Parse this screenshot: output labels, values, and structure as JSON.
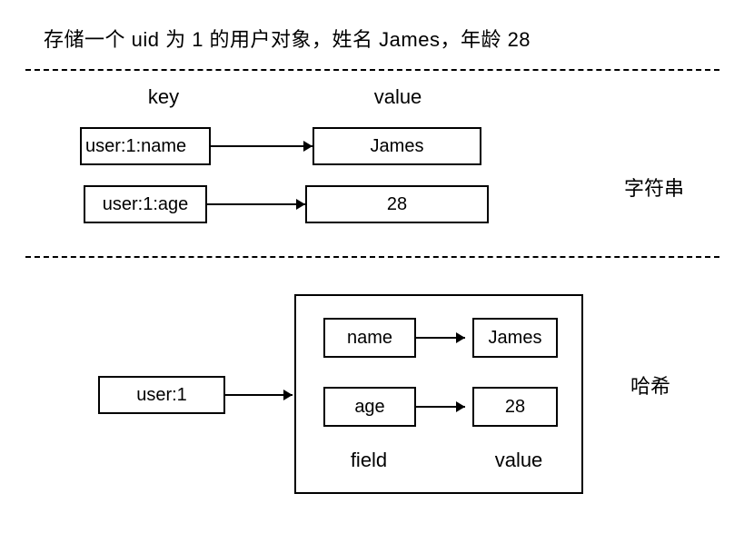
{
  "title": "存储一个 uid 为 1 的用户对象，姓名 James，年龄 28",
  "headers": {
    "key": "key",
    "value": "value",
    "field": "field",
    "value2": "value"
  },
  "section_labels": {
    "string": "字符串",
    "hash": "哈希"
  },
  "string_section": {
    "row1": {
      "key": "user:1:name",
      "value": "James"
    },
    "row2": {
      "key": "user:1:age",
      "value": "28"
    }
  },
  "hash_section": {
    "key": "user:1",
    "fields": {
      "row1": {
        "field": "name",
        "value": "James"
      },
      "row2": {
        "field": "age",
        "value": "28"
      }
    }
  }
}
